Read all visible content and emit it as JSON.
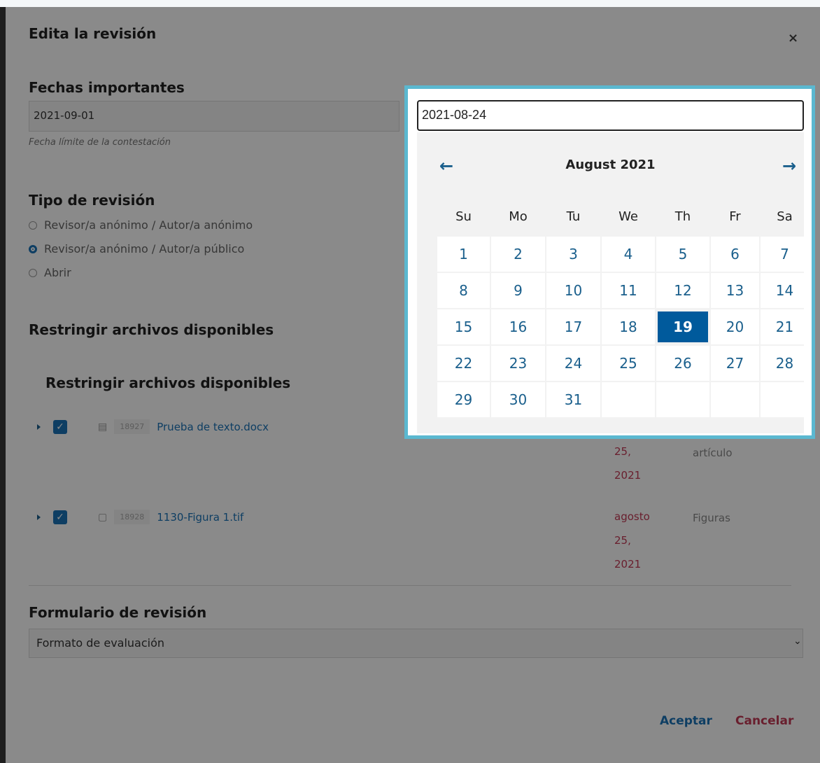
{
  "modal": {
    "title": "Edita la revisión",
    "close": "×"
  },
  "dates_section": {
    "label": "Fechas importantes",
    "response_deadline": "2021-09-01",
    "response_hint": "Fecha límite de la contestación",
    "review_deadline": "2021-08-24"
  },
  "review_type": {
    "label": "Tipo de revisión",
    "options": [
      {
        "label": "Revisor/a anónimo / Autor/a anónimo",
        "checked": false
      },
      {
        "label": "Revisor/a anónimo / Autor/a público",
        "checked": true
      },
      {
        "label": "Abrir",
        "checked": false
      }
    ]
  },
  "files": {
    "section_label": "Restringir archivos disponibles",
    "inner_label": "Restringir archivos disponibles",
    "rows": [
      {
        "id": "18927",
        "name": "Prueba de texto.docx",
        "date": [
          "25,",
          "2021"
        ],
        "type": "artículo"
      },
      {
        "id": "18928",
        "name": "1130-Figura 1.tif",
        "date": [
          "agosto",
          "25,",
          "2021"
        ],
        "type": "Figuras"
      }
    ]
  },
  "review_form": {
    "label": "Formulario de revisión",
    "selected": "Formato de evaluación"
  },
  "buttons": {
    "accept": "Aceptar",
    "cancel": "Cancelar"
  },
  "datepicker": {
    "month_label": "August 2021",
    "prev": "←",
    "next": "→",
    "weekdays": [
      "Su",
      "Mo",
      "Tu",
      "We",
      "Th",
      "Fr",
      "Sa"
    ],
    "days": [
      "1",
      "2",
      "3",
      "4",
      "5",
      "6",
      "7",
      "8",
      "9",
      "10",
      "11",
      "12",
      "13",
      "14",
      "15",
      "16",
      "17",
      "18",
      "19",
      "20",
      "21",
      "22",
      "23",
      "24",
      "25",
      "26",
      "27",
      "28",
      "29",
      "30",
      "31"
    ],
    "selected_day": "19",
    "trailing_empty": 4
  },
  "colors": {
    "accent": "#1a73b8",
    "selected_day": "#005a9c",
    "danger": "#c33a55",
    "highlight_frame": "#5bb8d0"
  }
}
